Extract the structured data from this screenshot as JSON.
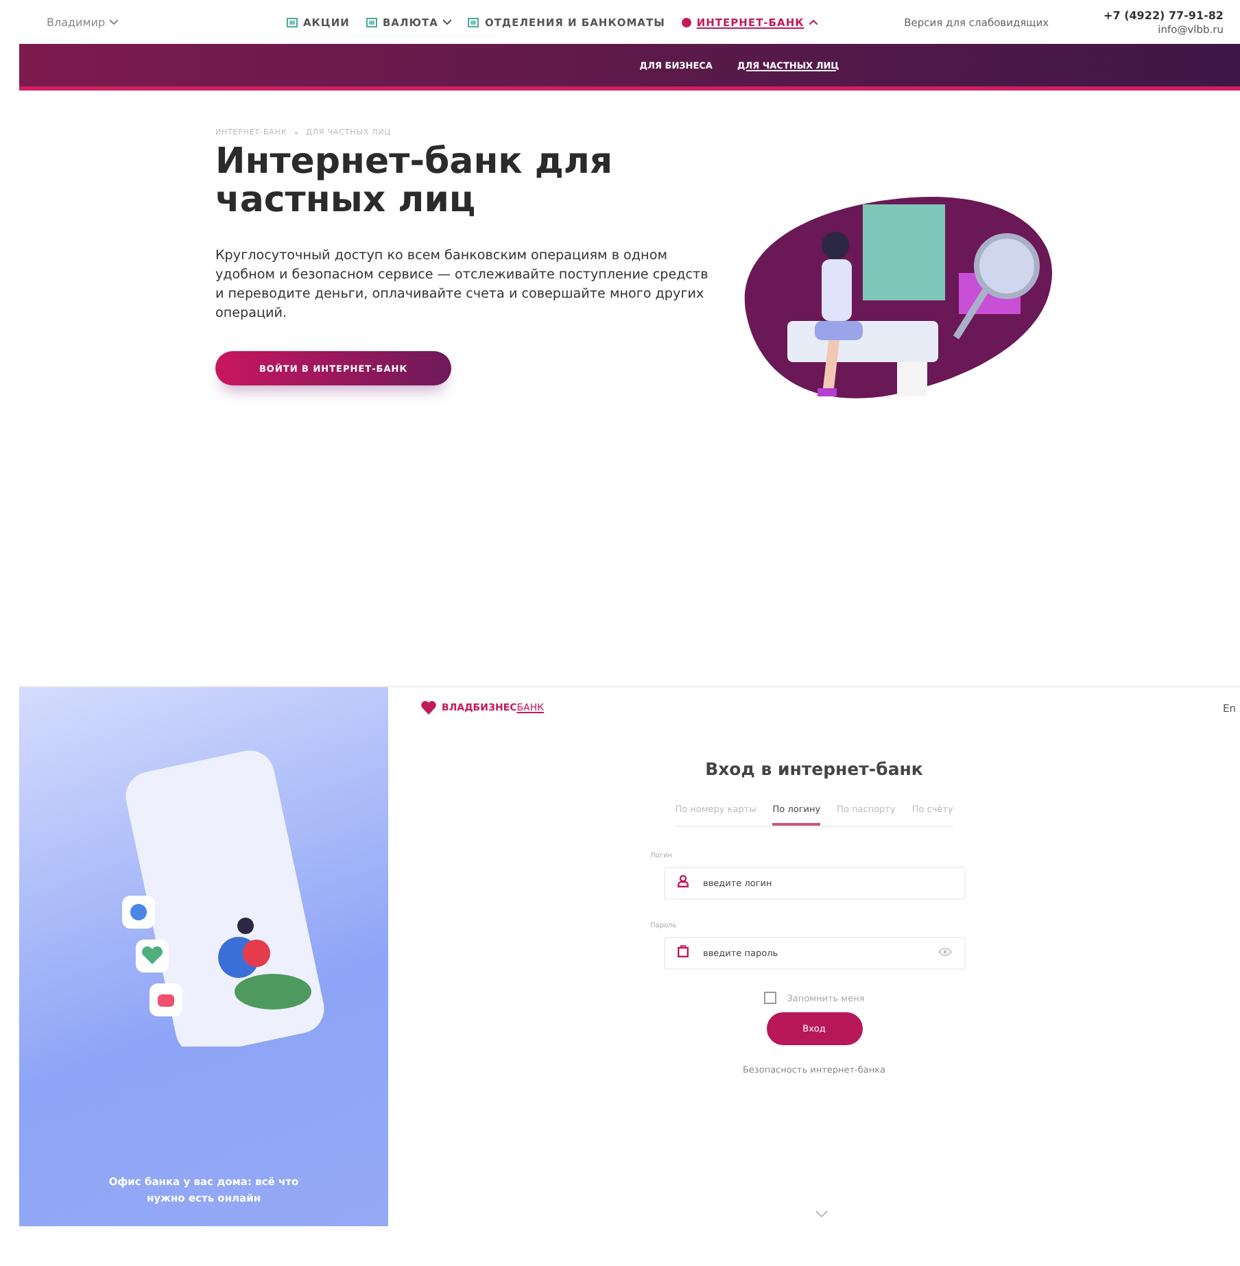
{
  "top_nav": {
    "city": "Владимир",
    "menu": [
      {
        "label": "АКЦИИ",
        "dropdown": false,
        "selected": false
      },
      {
        "label": "ВАЛЮТА",
        "dropdown": true,
        "expanded": false,
        "selected": false
      },
      {
        "label": "ОТДЕЛЕНИЯ И БАНКОМАТЫ",
        "dropdown": false,
        "selected": false
      },
      {
        "label": "ИНТЕРНЕТ-БАНК",
        "dropdown": true,
        "expanded": true,
        "selected": true
      }
    ],
    "accessibility_link": "Версия для слабовидящих",
    "phone": "+7 (4922) 77-91-82",
    "email": "info@vlbb.ru"
  },
  "sub_nav": [
    {
      "label": "ДЛЯ БИЗНЕСА",
      "selected": false
    },
    {
      "label": "ДЛЯ ЧАСТНЫХ ЛИЦ",
      "selected": true
    }
  ],
  "hero": {
    "breadcrumbs": [
      "ИНТЕРНЕТ-БАНК",
      "ДЛЯ ЧАСТНЫХ ЛИЦ"
    ],
    "title": "Интернет-банк для частных лиц",
    "text": "Круглосуточный доступ ко всем банковским операциям в одном удобном и безопасном сервисе — отслеживайте поступление средств и переводите деньги, оплачивайте счета и совершайте много других операций.",
    "button": "ВОЙТИ В ИНТЕРНЕТ-БАНК"
  },
  "login": {
    "promo": "Офис банка у вас дома: всё что нужно есть онлайн",
    "logo_strong": "ВЛАДБИЗНЕС",
    "logo_light": "БАНК",
    "language": "En",
    "heading": "Вход в интернет-банк",
    "tabs": [
      {
        "label": "По номеру карты",
        "selected": false
      },
      {
        "label": "По логину",
        "selected": true
      },
      {
        "label": "По паспорту",
        "selected": false
      },
      {
        "label": "По счёту",
        "selected": false
      }
    ],
    "fields": [
      {
        "kind": "login",
        "label": "Логин",
        "placeholder": "введите логин"
      },
      {
        "kind": "password",
        "label": "Пароль",
        "placeholder": "введите пароль"
      }
    ],
    "remember": {
      "label": "Запомнить меня",
      "checked": false
    },
    "submit": "Вход",
    "security_link": "Безопасность интернет-банка"
  }
}
